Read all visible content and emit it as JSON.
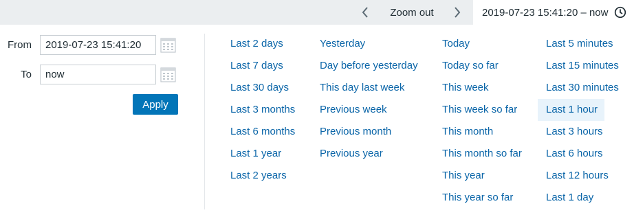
{
  "topbar": {
    "zoom_out_label": "Zoom out",
    "range_label": "2019-07-23 15:41:20 – now",
    "icons": {
      "prev": "chevron-left-icon",
      "next": "chevron-right-icon",
      "clock": "clock-icon"
    }
  },
  "form": {
    "from_label": "From",
    "from_value": "2019-07-23 15:41:20",
    "to_label": "To",
    "to_value": "now",
    "apply_label": "Apply",
    "icons": {
      "calendar": "calendar-icon"
    }
  },
  "quick_ranges": {
    "columns": [
      [
        "Last 2 days",
        "Last 7 days",
        "Last 30 days",
        "Last 3 months",
        "Last 6 months",
        "Last 1 year",
        "Last 2 years"
      ],
      [
        "Yesterday",
        "Day before yesterday",
        "This day last week",
        "Previous week",
        "Previous month",
        "Previous year"
      ],
      [
        "Today",
        "Today so far",
        "This week",
        "This week so far",
        "This month",
        "This month so far",
        "This year",
        "This year so far"
      ],
      [
        "Last 5 minutes",
        "Last 15 minutes",
        "Last 30 minutes",
        "Last 1 hour",
        "Last 3 hours",
        "Last 6 hours",
        "Last 12 hours",
        "Last 1 day"
      ]
    ],
    "selected": "Last 1 hour"
  },
  "colors": {
    "link": "#0a65a8",
    "button": "#0275b8",
    "selected_bg": "#e8f3fb",
    "topbar_bg": "#ebeef0"
  }
}
